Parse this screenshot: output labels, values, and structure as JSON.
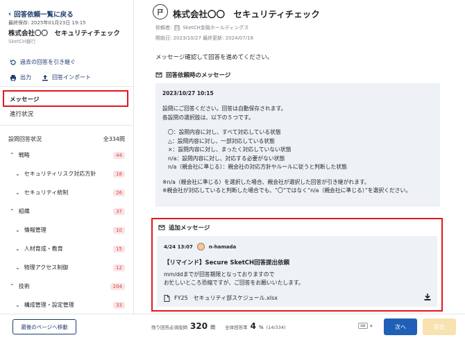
{
  "sidebar": {
    "back_label": "回答依頼一覧に戻る",
    "saved_at": "最終保存: 2025年01月23日 19:15",
    "company_title": "株式会社〇〇　セキュリティチェック",
    "bank_name": "SketCH銀行",
    "inherit_label": "過去の回答を引き継ぐ",
    "output_label": "出力",
    "import_label": "回答インポート",
    "nav_message": "メッセージ",
    "nav_progress": "進行状況",
    "status_label": "設問回答状況",
    "status_total": "全334問",
    "tree": [
      {
        "label": "戦略",
        "count": "44",
        "level": 0
      },
      {
        "label": "セキュリティリスク対応方針",
        "count": "18",
        "level": 1
      },
      {
        "label": "セキュリティ統制",
        "count": "26",
        "level": 1
      },
      {
        "label": "組織",
        "count": "37",
        "level": 0
      },
      {
        "label": "情報管理",
        "count": "10",
        "level": 1
      },
      {
        "label": "人材育成・教育",
        "count": "15",
        "level": 1
      },
      {
        "label": "物理アクセス制御",
        "count": "12",
        "level": 1
      },
      {
        "label": "技術",
        "count": "204",
        "level": 0
      },
      {
        "label": "構成管理・設定管理",
        "count": "33",
        "level": 1
      }
    ]
  },
  "main": {
    "title": "株式会社〇〇　セキュリティチェック",
    "requester_label": "依頼者:",
    "requester": "SketCH金融ホールディングス",
    "dates": "開始日: 2023/10/27 最終更新: 2024/07/18",
    "intro": "メッセージ確認して回答を進めてください。",
    "request_msg_head": "回答依頼時のメッセージ",
    "request_msg": {
      "date": "2023/10/27 10:15",
      "lines1": [
        "設問にご回答ください。回答は自動保存されます。",
        "各設問の選択肢は、以下の５つです。"
      ],
      "lines2": [
        "〇：設問内容に対し、すべて対応している状態",
        "△：設問内容に対し、一部対応している状態",
        "×：設問内容に対し、まったく対応していない状態",
        "n/a：設問内容に対し、対応する必要がない状態",
        "n/a（親会社に準じる）：親会社の対応方針やルールに従うと判断した状態"
      ],
      "lines3": [
        "※n/a（親会社に準じる）を選択した場合、親会社が選択した回答が引き継がれます。",
        "※親会社が対応していると判断した場合でも、“〇”ではなく“n/a（親会社に準じる）”を選択ください。"
      ]
    },
    "add_msg_head": "追加メッセージ",
    "add_msg": {
      "time": "4/24 13:07",
      "user": "n-hamada",
      "title": "【リマインド】Secure SketCH回答提出依頼",
      "body": [
        "mm/ddまでが回答期限となっておりますので",
        "お忙しいところ恐縮ですが、ご回答をお願いいたします。"
      ],
      "attachment": "FY25　セキュリティ部スケジュール.xlsx"
    }
  },
  "footer": {
    "last_page": "最後のページへ移動",
    "remain_label": "残り回答必須設問",
    "remain_value": "320",
    "remain_unit": "問",
    "rate_label": "全体回答率",
    "rate_value": "4",
    "rate_unit": "%",
    "rate_detail": "(14/334)",
    "next": "次へ",
    "submit": "提出"
  },
  "colors": {
    "accent": "#1f5fb8",
    "highlight": "#e0171c",
    "badge_bg": "#fbe3e4",
    "badge_fg": "#d1494e"
  }
}
